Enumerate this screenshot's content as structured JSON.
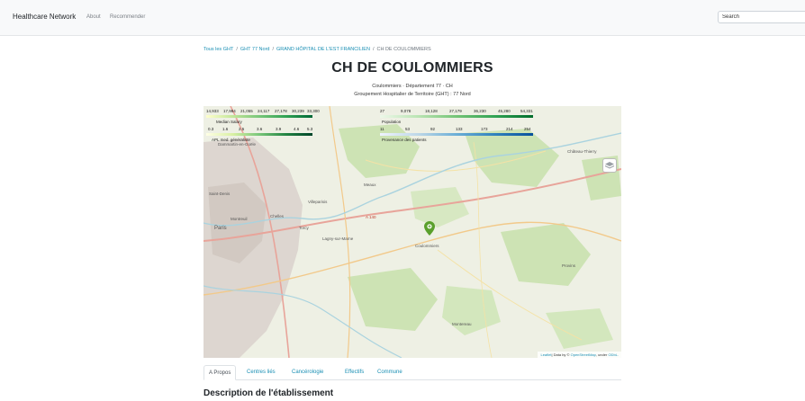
{
  "navbar": {
    "brand": "Healthcare Network",
    "links": [
      "About",
      "Recommender"
    ],
    "search_placeholder": "Search"
  },
  "breadcrumb": {
    "items": [
      "Tous les GHT",
      "GHT 77 Nord",
      "GRAND HÔPITAL DE L'EST FRANCILIEN"
    ],
    "current": "CH DE COULOMMIERS"
  },
  "page": {
    "title": "CH DE COULOMMIERS",
    "subtitle": "Coulommiers · Département 77 · CH",
    "group_line": "Groupement Hospitalier de Territoire (GHT) : 77 Nord"
  },
  "map": {
    "legends": [
      {
        "label": "Median Salary",
        "ticks": [
          "14,933",
          "17,984",
          "21,055",
          "24,117",
          "27,178",
          "30,239",
          "33,300"
        ],
        "colors": [
          "#ffffcc",
          "#c2e699",
          "#78c679",
          "#31a354",
          "#006837"
        ]
      },
      {
        "label": "Population",
        "ticks": [
          "27",
          "9,078",
          "18,128",
          "27,179",
          "36,230",
          "45,280",
          "54,331"
        ],
        "colors": [
          "#edf8e9",
          "#bae4b3",
          "#74c476",
          "#31a354",
          "#006d2c"
        ]
      },
      {
        "label": "APL med. généraliste",
        "ticks": [
          "0.3",
          "1.6",
          "2.5",
          "3.6",
          "3.9",
          "4.6",
          "5.3"
        ],
        "colors": [
          "#ffffe5",
          "#d9f0a3",
          "#78c679",
          "#238443",
          "#004529"
        ]
      },
      {
        "label": "Provenance des patients",
        "ticks": [
          "11",
          "53",
          "92",
          "133",
          "173",
          "214",
          "254"
        ],
        "colors": [
          "#eff3ff",
          "#bdd7e7",
          "#6baed6",
          "#3182bd",
          "#08519c"
        ]
      }
    ],
    "places": [
      "Dammartin-en-Goële",
      "Château-Thierry",
      "Saint-Denis",
      "Paris",
      "Montreuil",
      "Meaux",
      "Coulommiers",
      "Chelles",
      "Torcy",
      "Montereau",
      "Provins",
      "Villeparisis",
      "Lagny-sur-Marne"
    ],
    "road_label": "A 140",
    "marker_icon": "hospital-marker-icon",
    "attribution": {
      "leaflet": "Leaflet",
      "text": "| Data by © ",
      "osm": "OpenStreetMap",
      "under": ", under ",
      "license": "ODbL."
    }
  },
  "tabs": [
    {
      "label": "A Propos",
      "active": true
    },
    {
      "label": "Centres liés",
      "active": false
    },
    {
      "label": "Cancérologie",
      "active": false
    },
    {
      "label": "Effectifs",
      "active": false
    },
    {
      "label": "Commune",
      "active": false
    }
  ],
  "section": {
    "heading": "Description de l'établissement"
  }
}
